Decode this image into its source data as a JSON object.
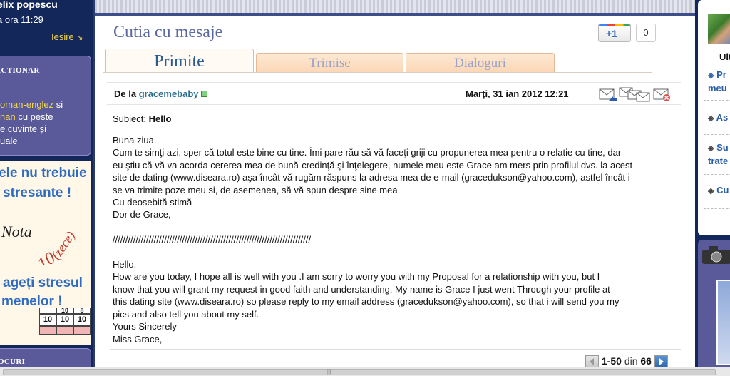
{
  "user": {
    "name": "elix popescu",
    "time": "a ora 11:29",
    "logout": "Iesire"
  },
  "dictionary": {
    "title": "ICTIONAR",
    "line1a": "oman-englez",
    "line1b": " si",
    "line2a": "nan",
    "line2b": " cu peste",
    "line3": "e cuvinte și",
    "line4": "uale"
  },
  "ad": {
    "line1": "ele nu trebuie",
    "line2": "stresante !",
    "nota": "Nota",
    "zece": "(zece)",
    "ten": "10",
    "line3": "ageți stresul",
    "line4": "menelor !",
    "grid_top": [
      "",
      "10",
      "8"
    ],
    "grid_mid": [
      "10",
      "10",
      "10"
    ]
  },
  "bottom_left": {
    "title": "OCURI"
  },
  "main": {
    "title": "Cutia cu mesaje",
    "gplus_label": "+1",
    "gplus_count": "0",
    "tabs": [
      {
        "label": "Primite"
      },
      {
        "label": "Trimise"
      },
      {
        "label": "Dialoguri"
      }
    ]
  },
  "message": {
    "from_label": "De la",
    "from_user": "gracemebaby",
    "date": "Marţi, 31 ian 2012 12:21",
    "subject_label": "Subiect:",
    "subject": "Hello",
    "body": "Buna ziua.\nCum te simţi azi, sper că totul este bine cu tine. Îmi pare rău să vă faceţi griji cu propunerea mea pentru o relatie cu tine, dar\neu ştiu că vă va acorda cererea mea de bună-credinţă şi înţelegere, numele meu este Grace am mers prin profilul dvs. la acest\nsite de dating (www.diseara.ro) aşa încât vă rugăm răspuns la adresa mea de e-mail (gracedukson@yahoo.com), astfel încât i\nse va trimite poze meu si, de asemenea, să vă spun despre sine mea.\nCu deosebită stimă\nDor de Grace,\n\n/////////////////////////////////////////////////////////////////////////////\n\nHello.\nHow are you today, I hope all is well with you .I am sorry to worry you with my Proposal for a relationship with you, but I\nknow that you will grant my request in good faith and understanding, My name is Grace I just went Through your profile at\nthis dating site (www.diseara.ro) so please reply to my email address (gracedukson@yahoo.com), so that i will send you my\npics and also tell you about my self.\nYours Sincerely\nMiss Grace,"
  },
  "pager": {
    "range": "1-50",
    "din": "din",
    "total": "66"
  },
  "right": {
    "ult": "Ult",
    "links": [
      {
        "line1": "Pr",
        "line2": "meu"
      },
      {
        "line1": "As"
      },
      {
        "line1": "Su",
        "line2": "trate"
      },
      {
        "line1": "Cu"
      }
    ]
  }
}
